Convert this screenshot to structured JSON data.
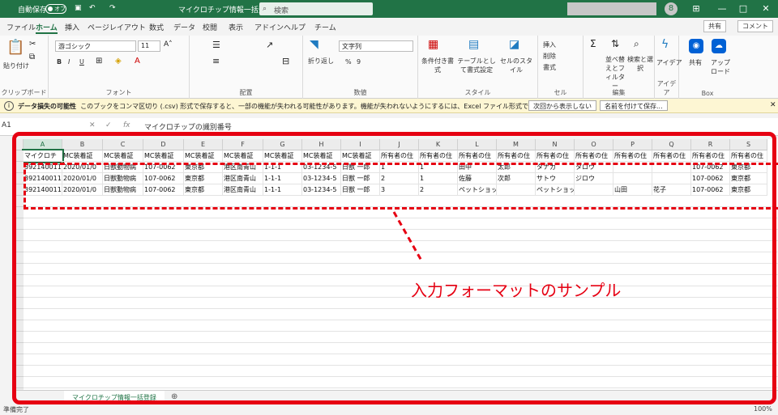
{
  "titlebar": {
    "autosave_label": "自動保存",
    "autosave_state": "オフ",
    "filename": "マイクロチップ情報一括登録.csv",
    "search_placeholder": "検索",
    "avatar_initial": "8",
    "minimize": "—",
    "restore": "□",
    "close": "✕"
  },
  "tabs": [
    "ファイル",
    "ホーム",
    "挿入",
    "ページレイアウト",
    "数式",
    "データ",
    "校閲",
    "表示",
    "アドイン",
    "ヘルプ",
    "チーム"
  ],
  "active_tab": "ホーム",
  "share_label": "共有",
  "comment_label": "コメント",
  "ribbon": {
    "clipboard": {
      "paste": "貼り付け",
      "group": "クリップボード"
    },
    "font": {
      "name": "游ゴシック",
      "size": "11",
      "bold": "B",
      "italic": "I",
      "underline": "U",
      "group": "フォント"
    },
    "alignment": {
      "group": "配置"
    },
    "number": {
      "wrap": "折り返し",
      "format": "文字列",
      "percent": "%",
      "comma": "9",
      "group": "数値"
    },
    "styles": {
      "conditional": "条件付き書式",
      "table": "テーブルとして書式設定",
      "cell": "セルのスタイル",
      "group": "スタイル"
    },
    "cells": {
      "insert": "挿入",
      "delete": "削除",
      "format": "書式",
      "group": "セル"
    },
    "editing": {
      "sort": "並べ替えとフィルター",
      "find": "検索と選択",
      "group": "編集"
    },
    "ideas": {
      "label": "アイデア",
      "group": "アイデア"
    },
    "box": {
      "share": "共有",
      "upload": "アップロード",
      "group": "Box"
    }
  },
  "warning": {
    "title": "データ損失の可能性",
    "message": "このブックをコンマ区切り (.csv) 形式で保存すると、一部の機能が失われる可能性があります。機能が失われないようにするには、Excel ファイル形式で保存してください。",
    "dismiss": "次回から表示しない",
    "save_as": "名前を付けて保存..."
  },
  "formula_bar": {
    "name_box": "A1",
    "cancel": "✕",
    "enter": "✓",
    "fx": "fx",
    "formula": "マイクロチップの識別番号"
  },
  "columns": [
    "A",
    "B",
    "C",
    "D",
    "E",
    "F",
    "G",
    "H",
    "I",
    "J",
    "K",
    "L",
    "M",
    "N",
    "O",
    "P",
    "Q",
    "R",
    "S"
  ],
  "header_row": [
    "マイクロチ",
    "MC装着証",
    "MC装着証",
    "MC装着証",
    "MC装着証",
    "MC装着証",
    "MC装着証",
    "MC装着証",
    "MC装着証",
    "所有者の住",
    "所有者の住",
    "所有者の住",
    "所有者の住",
    "所有者の住",
    "所有者の住",
    "所有者の住",
    "所有者の住",
    "所有者の住",
    "所有者の住"
  ],
  "rows": [
    [
      "392140011",
      "2020/01/0",
      "日獣動物病",
      "107-0062",
      "東京都",
      "港区南青山",
      "1-1-1",
      "03-1234-5",
      "日獣 一郎",
      "1",
      "1",
      "田中",
      "太郎",
      "タナカ",
      "タロウ",
      "",
      "",
      "107-0062",
      "東京都"
    ],
    [
      "392140011",
      "2020/01/0",
      "日獣動物病",
      "107-0062",
      "東京都",
      "港区南青山",
      "1-1-1",
      "03-1234-5",
      "日獣 一郎",
      "2",
      "1",
      "佐藤",
      "次郎",
      "サトウ",
      "ジロウ",
      "",
      "",
      "107-0062",
      "東京都"
    ],
    [
      "392140011",
      "2020/01/0",
      "日獣動物病",
      "107-0062",
      "東京都",
      "港区南青山",
      "1-1-1",
      "03-1234-5",
      "日獣 一郎",
      "3",
      "2",
      "ペットショップ山田",
      "",
      "ペットショップヤマダ",
      "",
      "山田",
      "花子",
      "107-0062",
      "東京都"
    ]
  ],
  "overflow_last": "港",
  "sheet_tab": "マイクロチップ情報一括登録",
  "add_sheet": "⊕",
  "status": {
    "ready": "準備完了",
    "zoom": "100%"
  },
  "annotation": "入力フォーマットのサンプル",
  "colors": {
    "excel_green": "#217346",
    "annotation_red": "#e60012"
  }
}
